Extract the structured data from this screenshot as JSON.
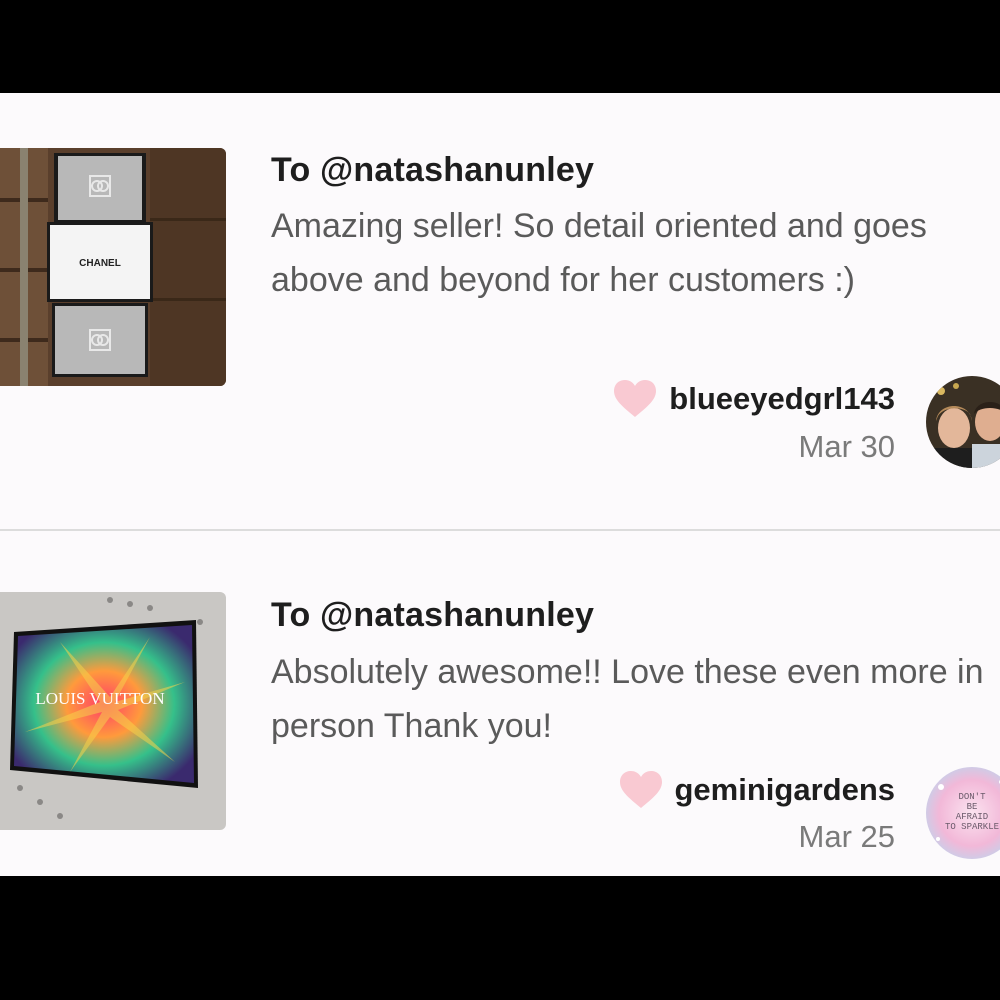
{
  "reviews": [
    {
      "recipient": "To @natashanunley",
      "message": "Amazing seller! So detail oriented and goes above and beyond for her customers :)",
      "username": "blueeyedgrl143",
      "date": "Mar 30",
      "thumbnail_text": "CHANEL",
      "heart_color": "#f9c9d2"
    },
    {
      "recipient": "To @natashanunley",
      "message": "Absolutely awesome!! Love these even more in person Thank you!",
      "username": "geminigardens",
      "date": "Mar 25",
      "thumbnail_text": "LOUIS VUITTON",
      "avatar_text": "DON'T BE AFRAID TO SPARKLE",
      "heart_color": "#f9c9d2"
    }
  ]
}
